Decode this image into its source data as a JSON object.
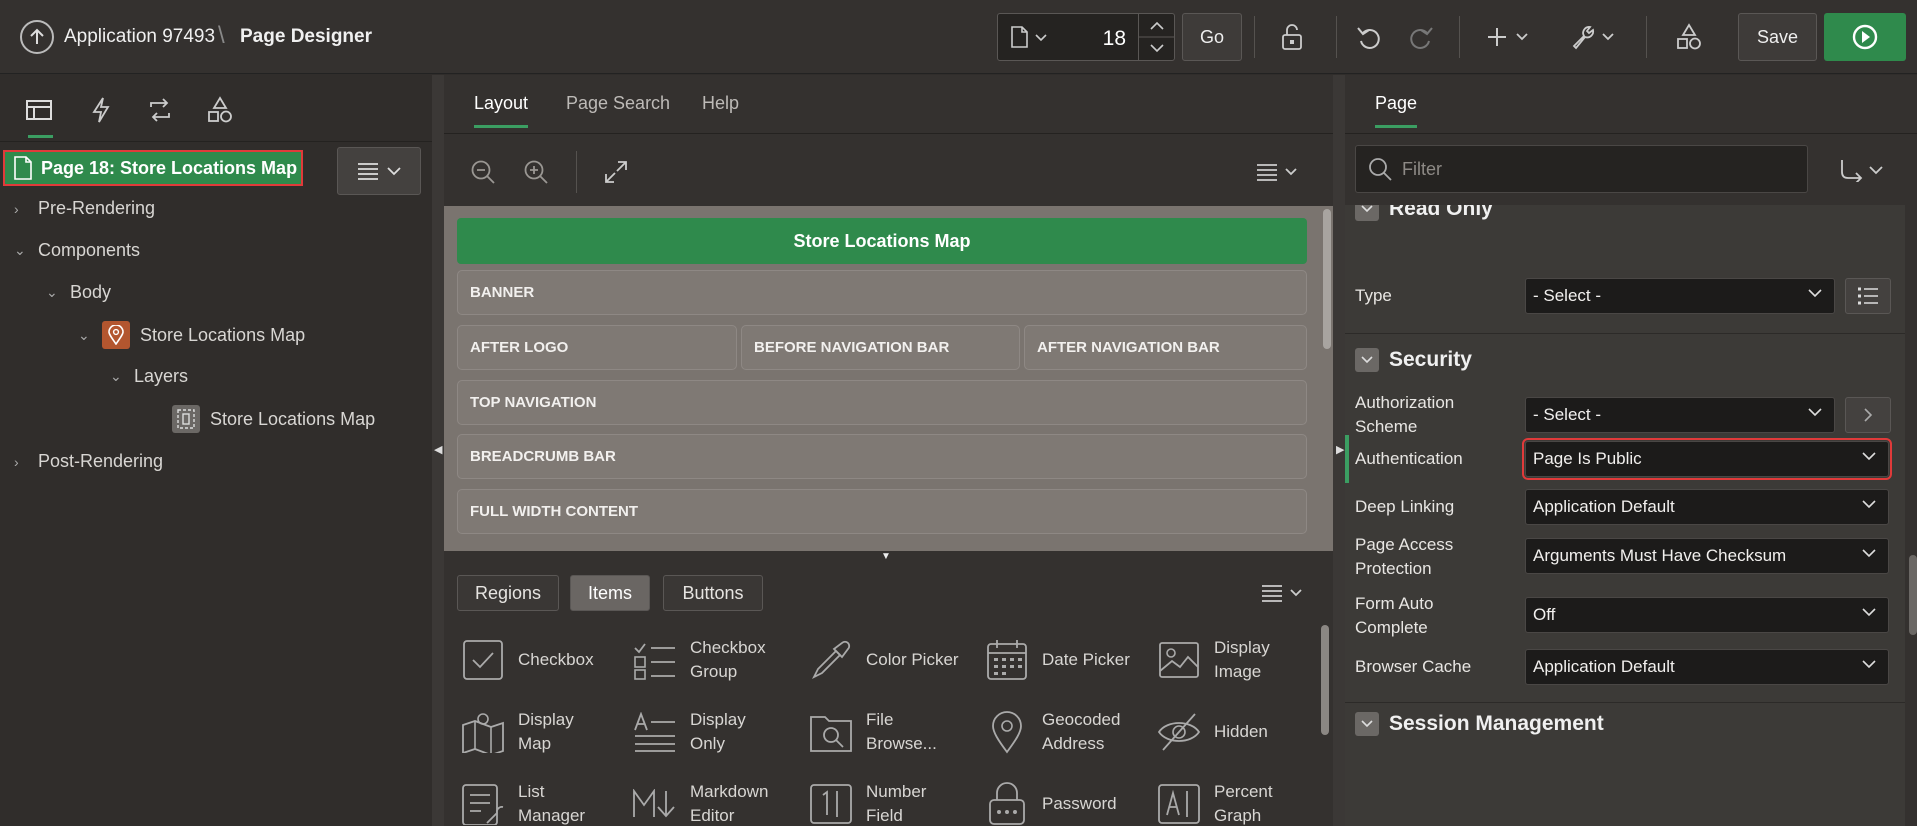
{
  "header": {
    "app_name": "Application 97493",
    "separator": "\\",
    "page_designer": "Page Designer",
    "page_number": "18",
    "go_label": "Go",
    "save_label": "Save",
    "accent_green": "#2f8a4c"
  },
  "left": {
    "page_node": "Page 18: Store Locations Map",
    "tree": {
      "pre_rendering": "Pre-Rendering",
      "components": "Components",
      "body": "Body",
      "map_region": "Store Locations Map",
      "layers": "Layers",
      "layer_item": "Store Locations Map",
      "post_rendering": "Post-Rendering"
    }
  },
  "center": {
    "tabs": [
      "Layout",
      "Page Search",
      "Help"
    ],
    "canvas": {
      "title": "Store Locations Map",
      "banner": "BANNER",
      "after_logo": "AFTER LOGO",
      "before_nav": "BEFORE NAVIGATION BAR",
      "after_nav": "AFTER NAVIGATION BAR",
      "top_nav": "TOP NAVIGATION",
      "breadcrumb": "BREADCRUMB BAR",
      "full_width": "FULL WIDTH CONTENT"
    },
    "gallery_tabs": [
      "Regions",
      "Items",
      "Buttons"
    ],
    "gallery_items": [
      "Checkbox",
      "Checkbox\nGroup",
      "Color Picker",
      "Date Picker",
      "Display\nImage",
      "Display\nMap",
      "Display\nOnly",
      "File\nBrowse...",
      "Geocoded\nAddress",
      "Hidden",
      "List\nManager",
      "Markdown\nEditor",
      "Number\nField",
      "Password",
      "Percent\nGraph"
    ]
  },
  "right": {
    "tab": "Page",
    "filter_placeholder": "Filter",
    "read_only_section": "Read Only",
    "type_label": "Type",
    "type_value": "- Select -",
    "security_section": "Security",
    "auth_scheme_label": "Authorization\nScheme",
    "auth_scheme_value": "- Select -",
    "authentication_label": "Authentication",
    "authentication_value": "Page Is Public",
    "deep_linking_label": "Deep Linking",
    "deep_linking_value": "Application Default",
    "page_access_label": "Page Access\nProtection",
    "page_access_value": "Arguments Must Have Checksum",
    "form_auto_label": "Form Auto\nComplete",
    "form_auto_value": "Off",
    "browser_cache_label": "Browser Cache",
    "browser_cache_value": "Application Default",
    "session_section": "Session Management"
  }
}
